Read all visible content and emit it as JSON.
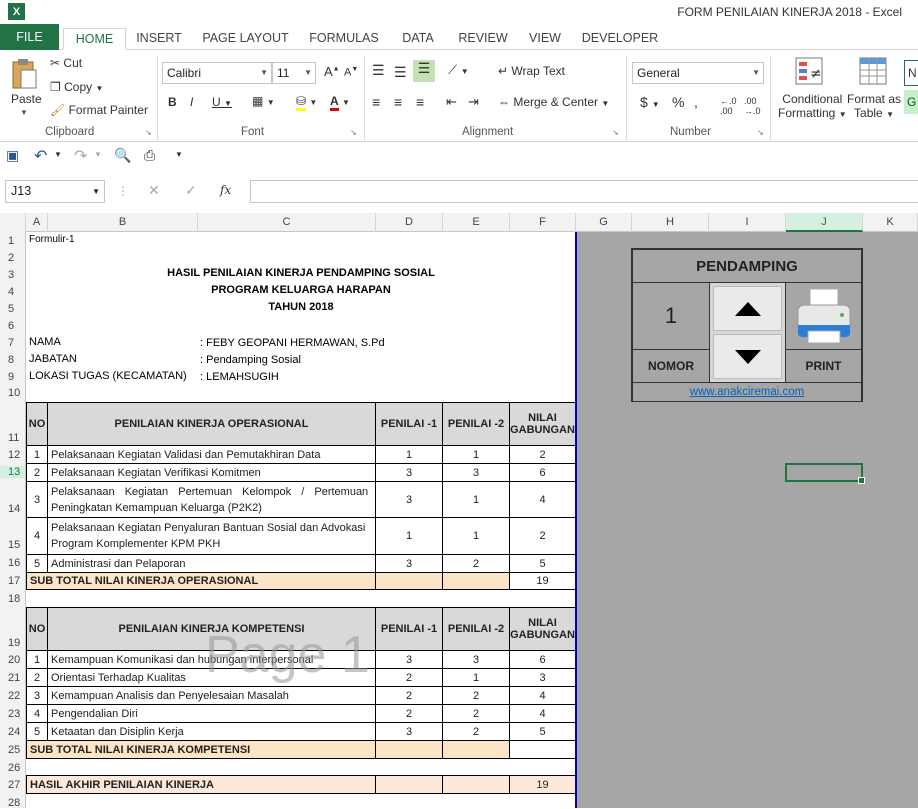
{
  "window": {
    "title": "FORM PENILAIAN KINERJA 2018 - Excel",
    "logo": "X"
  },
  "tabs": [
    "FILE",
    "HOME",
    "INSERT",
    "PAGE LAYOUT",
    "FORMULAS",
    "DATA",
    "REVIEW",
    "VIEW",
    "DEVELOPER"
  ],
  "ribbon": {
    "paste": "Paste",
    "cut": "Cut",
    "copy": "Copy",
    "format_painter": "Format Painter",
    "clipboard": "Clipboard",
    "font_name": "Calibri",
    "font_size": "11",
    "font": "Font",
    "wrap_text": "Wrap Text",
    "merge_center": "Merge & Center",
    "alignment": "Alignment",
    "number_format": "General",
    "number": "Number",
    "conditional_formatting_1": "Conditional",
    "conditional_formatting_2": "Formatting",
    "format_table_1": "Format as",
    "format_table_2": "Table"
  },
  "formula_bar": {
    "name_box": "J13",
    "fx": "fx",
    "value": ""
  },
  "columns": [
    "A",
    "B",
    "C",
    "D",
    "E",
    "F",
    "G",
    "H",
    "I",
    "J",
    "K"
  ],
  "rows": [
    "1",
    "2",
    "3",
    "4",
    "5",
    "6",
    "7",
    "8",
    "9",
    "10",
    "11",
    "12",
    "13",
    "14",
    "15",
    "16",
    "17",
    "18",
    "19",
    "20",
    "21",
    "22",
    "23",
    "24",
    "25",
    "26",
    "27",
    "28"
  ],
  "form": {
    "label": "Formulir-1",
    "title1": "HASIL PENILAIAN KINERJA PENDAMPING SOSIAL",
    "title2": "PROGRAM KELUARGA HARAPAN",
    "title3": "TAHUN 2018",
    "nama_label": "NAMA",
    "nama_value": ": FEBY GEOPANI HERMAWAN, S.Pd",
    "jabatan_label": "JABATAN",
    "jabatan_value": ": Pendamping Sosial",
    "lokasi_label": "LOKASI TUGAS (KECAMATAN)",
    "lokasi_value": ": LEMAHSUGIH"
  },
  "table1": {
    "h_no": "NO",
    "h_title": "PENILAIAN KINERJA OPERASIONAL",
    "h_p1": "PENILAI -1",
    "h_p2": "PENILAI -2",
    "h_g1": "NILAI",
    "h_g2": "GABUNGAN",
    "rows": [
      {
        "no": "1",
        "l1": "Pelaksanaan Kegiatan Validasi dan Pemutakhiran Data",
        "l2": "",
        "p1": "1",
        "p2": "1",
        "g": "2"
      },
      {
        "no": "2",
        "l1": "Pelaksanaan Kegiatan Verifikasi Komitmen",
        "l2": "",
        "p1": "3",
        "p2": "3",
        "g": "6"
      },
      {
        "no": "3",
        "l1": "Pelaksanaan  Kegiatan  Pertemuan  Kelompok  /  Pertemuan",
        "l2": "Peningkatan Kemampuan Keluarga (P2K2)",
        "p1": "3",
        "p2": "1",
        "g": "4"
      },
      {
        "no": "4",
        "l1": "Pelaksanaan Kegiatan Penyaluran Bantuan Sosial dan Advokasi",
        "l2": "Program Komplementer KPM PKH",
        "p1": "1",
        "p2": "1",
        "g": "2"
      },
      {
        "no": "5",
        "l1": "Administrasi dan Pelaporan",
        "l2": "",
        "p1": "3",
        "p2": "2",
        "g": "5"
      }
    ],
    "subtotal_label": "SUB TOTAL NILAI KINERJA OPERASIONAL",
    "subtotal_value": "19"
  },
  "table2": {
    "h_no": "NO",
    "h_title": "PENILAIAN KINERJA KOMPETENSI",
    "h_p1": "PENILAI -1",
    "h_p2": "PENILAI -2",
    "h_g1": "NILAI",
    "h_g2": "GABUNGAN",
    "rows": [
      {
        "no": "1",
        "l1": "Kemampuan Komunikasi dan hubungan interpersonal",
        "p1": "3",
        "p2": "3",
        "g": "6"
      },
      {
        "no": "2",
        "l1": "Orientasi Terhadap Kualitas",
        "p1": "2",
        "p2": "1",
        "g": "3"
      },
      {
        "no": "3",
        "l1": "Kemampuan Analisis dan Penyelesaian Masalah",
        "p1": "2",
        "p2": "2",
        "g": "4"
      },
      {
        "no": "4",
        "l1": "Pengendalian Diri",
        "p1": "2",
        "p2": "2",
        "g": "4"
      },
      {
        "no": "5",
        "l1": "Ketaatan dan Disiplin Kerja",
        "p1": "3",
        "p2": "2",
        "g": "5"
      }
    ],
    "subtotal_label": "SUB TOTAL NILAI KINERJA KOMPETENSI",
    "subtotal_value": ""
  },
  "final": {
    "label": "HASIL AKHIR PENILAIAN KINERJA",
    "value": "19"
  },
  "watermark": "Page 1",
  "panel": {
    "title": "PENDAMPING",
    "number": "1",
    "nomor_label": "NOMOR",
    "print_label": "PRINT",
    "link": "www.anakciremai.com"
  },
  "colors": {
    "excel_green": "#217346",
    "header_grey": "#d9d9d9",
    "subtotal_peach": "#fce4c8",
    "final_pink": "#fde9d9",
    "outside_grey": "#a6a6a6"
  }
}
